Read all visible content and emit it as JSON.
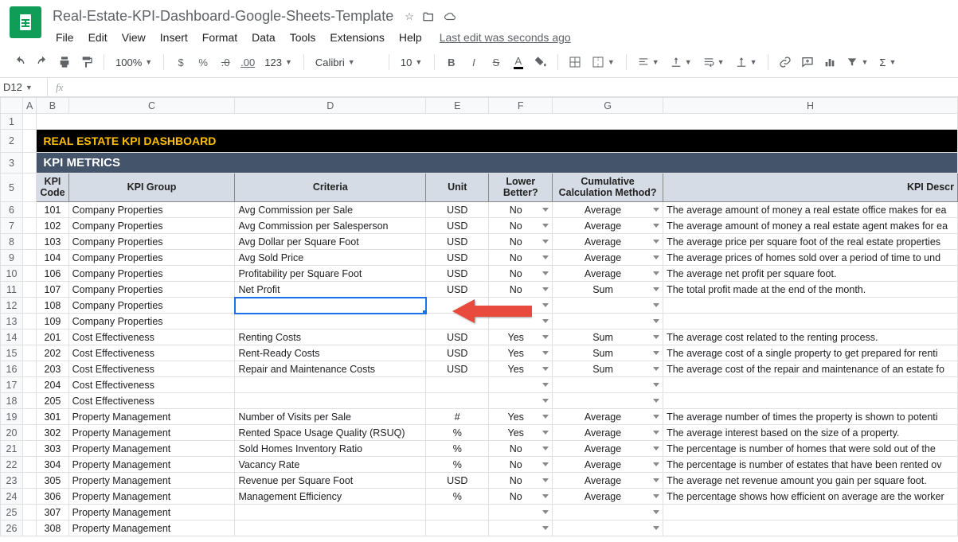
{
  "doc": {
    "title": "Real-Estate-KPI-Dashboard-Google-Sheets-Template",
    "last_edit": "Last edit was seconds ago"
  },
  "menus": [
    "File",
    "Edit",
    "View",
    "Insert",
    "Format",
    "Data",
    "Tools",
    "Extensions",
    "Help"
  ],
  "toolbar": {
    "zoom": "100%",
    "currency": "$",
    "percent": "%",
    "dec_dec": ".0",
    "inc_dec": ".00",
    "more_fmt": "123",
    "font": "Calibri",
    "font_size": "10"
  },
  "namebox": "D12",
  "fx_value": "",
  "columns": [
    "",
    "A",
    "B",
    "C",
    "D",
    "E",
    "F",
    "G",
    "H"
  ],
  "col_classes": [
    "row-hdr",
    "col-A",
    "col-B",
    "col-C",
    "col-D",
    "col-E",
    "col-F",
    "col-G",
    "col-H"
  ],
  "row_labels": [
    "1",
    "2",
    "3",
    "5",
    "6",
    "7",
    "8",
    "9",
    "10",
    "11",
    "12",
    "13",
    "14",
    "15",
    "16",
    "17",
    "18",
    "19",
    "20",
    "21",
    "22",
    "23",
    "24",
    "25",
    "26"
  ],
  "sheet": {
    "title_bar": "REAL ESTATE KPI DASHBOARD",
    "section": "KPI METRICS",
    "headers": {
      "kpi_code": "KPI Code",
      "kpi_group": "KPI Group",
      "criteria": "Criteria",
      "unit": "Unit",
      "lower_better": "Lower Better?",
      "calc_method": "Cumulative Calculation Method?",
      "desc": "KPI Descr"
    },
    "rows": [
      {
        "r": "6",
        "code": "101",
        "group": "Company Properties",
        "criteria": "Avg Commission per Sale",
        "unit": "USD",
        "lower": "No",
        "calc": "Average",
        "desc": "The average amount of money a real estate office makes for ea"
      },
      {
        "r": "7",
        "code": "102",
        "group": "Company Properties",
        "criteria": "Avg Commission per Salesperson",
        "unit": "USD",
        "lower": "No",
        "calc": "Average",
        "desc": "The average amount of money a real estate agent makes for ea"
      },
      {
        "r": "8",
        "code": "103",
        "group": "Company Properties",
        "criteria": "Avg Dollar per Square Foot",
        "unit": "USD",
        "lower": "No",
        "calc": "Average",
        "desc": "The average price per square foot of the real estate properties"
      },
      {
        "r": "9",
        "code": "104",
        "group": "Company Properties",
        "criteria": "Avg Sold Price",
        "unit": "USD",
        "lower": "No",
        "calc": "Average",
        "desc": "The average prices of homes sold over a period of time to und"
      },
      {
        "r": "10",
        "code": "106",
        "group": "Company Properties",
        "criteria": "Profitability per Square Foot",
        "unit": "USD",
        "lower": "No",
        "calc": "Average",
        "desc": "The average net profit per square foot."
      },
      {
        "r": "11",
        "code": "107",
        "group": "Company Properties",
        "criteria": "Net Profit",
        "unit": "USD",
        "lower": "No",
        "calc": "Sum",
        "desc": "The total profit made at the end of the month."
      },
      {
        "r": "12",
        "code": "108",
        "group": "Company Properties",
        "criteria": "",
        "unit": "",
        "lower": "",
        "calc": "",
        "desc": ""
      },
      {
        "r": "13",
        "code": "109",
        "group": "Company Properties",
        "criteria": "",
        "unit": "",
        "lower": "",
        "calc": "",
        "desc": ""
      },
      {
        "r": "14",
        "code": "201",
        "group": "Cost Effectiveness",
        "criteria": "Renting Costs",
        "unit": "USD",
        "lower": "Yes",
        "calc": "Sum",
        "desc": "The average cost related to the renting process."
      },
      {
        "r": "15",
        "code": "202",
        "group": "Cost Effectiveness",
        "criteria": "Rent-Ready Costs",
        "unit": "USD",
        "lower": "Yes",
        "calc": "Sum",
        "desc": "The average cost of a single property to get prepared for renti"
      },
      {
        "r": "16",
        "code": "203",
        "group": "Cost Effectiveness",
        "criteria": "Repair and Maintenance Costs",
        "unit": "USD",
        "lower": "Yes",
        "calc": "Sum",
        "desc": "The average cost of the repair and maintenance of an estate fo"
      },
      {
        "r": "17",
        "code": "204",
        "group": "Cost Effectiveness",
        "criteria": "",
        "unit": "",
        "lower": "",
        "calc": "",
        "desc": ""
      },
      {
        "r": "18",
        "code": "205",
        "group": "Cost Effectiveness",
        "criteria": "",
        "unit": "",
        "lower": "",
        "calc": "",
        "desc": ""
      },
      {
        "r": "19",
        "code": "301",
        "group": "Property Management",
        "criteria": "Number of Visits per Sale",
        "unit": "#",
        "lower": "Yes",
        "calc": "Average",
        "desc": "The average number of times the property is shown to potenti"
      },
      {
        "r": "20",
        "code": "302",
        "group": "Property Management",
        "criteria": "Rented Space Usage Quality (RSUQ)",
        "unit": "%",
        "lower": "Yes",
        "calc": "Average",
        "desc": "The average interest based on the size of a property."
      },
      {
        "r": "21",
        "code": "303",
        "group": "Property Management",
        "criteria": "Sold Homes Inventory Ratio",
        "unit": "%",
        "lower": "No",
        "calc": "Average",
        "desc": "The percentage is number of homes that were sold out of the"
      },
      {
        "r": "22",
        "code": "304",
        "group": "Property Management",
        "criteria": "Vacancy Rate",
        "unit": "%",
        "lower": "No",
        "calc": "Average",
        "desc": "The percentage is number of estates that have been rented ov"
      },
      {
        "r": "23",
        "code": "305",
        "group": "Property Management",
        "criteria": "Revenue per Square Foot",
        "unit": "USD",
        "lower": "No",
        "calc": "Average",
        "desc": "The average net revenue amount you gain per square foot."
      },
      {
        "r": "24",
        "code": "306",
        "group": "Property Management",
        "criteria": "Management Efficiency",
        "unit": "%",
        "lower": "No",
        "calc": "Average",
        "desc": "The percentage shows how efficient on average are the worker"
      },
      {
        "r": "25",
        "code": "307",
        "group": "Property Management",
        "criteria": "",
        "unit": "",
        "lower": "",
        "calc": "",
        "desc": ""
      },
      {
        "r": "26",
        "code": "308",
        "group": "Property Management",
        "criteria": "",
        "unit": "",
        "lower": "",
        "calc": "",
        "desc": ""
      }
    ]
  }
}
